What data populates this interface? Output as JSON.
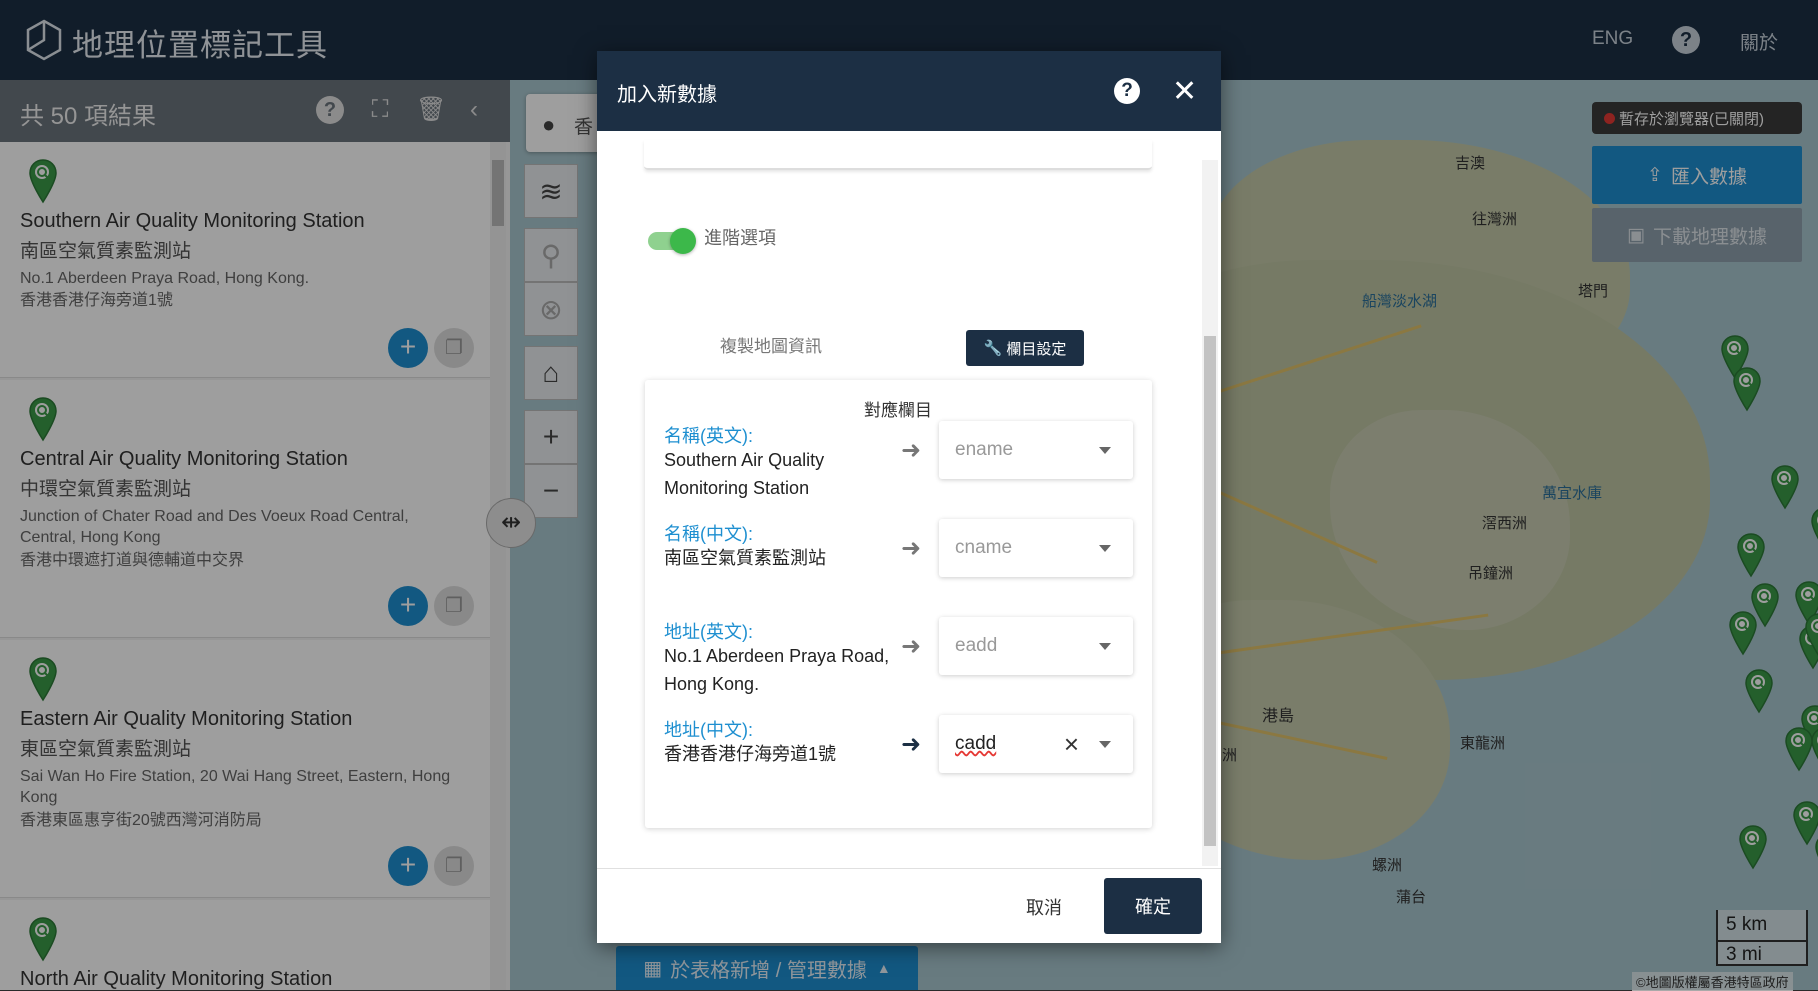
{
  "header": {
    "title": "地理位置標記工具",
    "lang": "ENG",
    "help": "?",
    "about": "關於"
  },
  "sidebar": {
    "result_count": "共 50 項結果",
    "items": [
      {
        "ename": "Southern Air Quality Monitoring Station",
        "cname": "南區空氣質素監測站",
        "eadd": "No.1 Aberdeen Praya Road, Hong Kong.",
        "cadd": "香港香港仔海旁道1號"
      },
      {
        "ename": "Central Air Quality Monitoring Station",
        "cname": "中環空氣質素監測站",
        "eadd": "Junction of Chater Road and Des Voeux Road Central, Central, Hong Kong",
        "cadd": "香港中環遮打道與德輔道中交界"
      },
      {
        "ename": "Eastern Air Quality Monitoring Station",
        "cname": "東區空氣質素監測站",
        "eadd": "Sai Wan Ho Fire Station, 20 Wai Hang Street, Eastern, Hong Kong",
        "cadd": "香港東區惠亨街20號西灣河消防局"
      },
      {
        "ename": "North Air Quality Monitoring Station"
      }
    ]
  },
  "map": {
    "search_placeholder": "香",
    "storage_badge": "暫存於瀏覽器(已關閉)",
    "import_label": "匯入數據",
    "download_label": "下載地理數據",
    "scale_km": "5 km",
    "scale_mi": "3 mi",
    "copyright": "©地圖版權屬香港特區政府",
    "places": [
      "吉澳",
      "往灣洲",
      "船灣淡水湖",
      "塔門",
      "萬宜水庫",
      "滘西洲",
      "吊鐘洲",
      "東龍洲",
      "蒲台",
      "螺洲",
      "港島",
      "洲"
    ],
    "table_button": "於表格新增 / 管理數據"
  },
  "modal": {
    "title": "加入新數據",
    "advanced_label": "進階選項",
    "copy_map_info": "複製地圖資訊",
    "column_settings": "欄目設定",
    "mapping_title": "對應欄目",
    "fields": [
      {
        "label": "名稱(英文):",
        "value": "Southern Air Quality Monitoring Station",
        "selected": "ename",
        "active": false
      },
      {
        "label": "名稱(中文):",
        "value": "南區空氣質素監測站",
        "selected": "cname",
        "active": false
      },
      {
        "label": "地址(英文):",
        "value": "No.1 Aberdeen Praya Road, Hong Kong.",
        "selected": "eadd",
        "active": false
      },
      {
        "label": "地址(中文):",
        "value": "香港香港仔海旁道1號",
        "selected": "cadd",
        "active": true
      }
    ],
    "cancel": "取消",
    "confirm": "確定"
  },
  "colors": {
    "header": "#1c2f44",
    "accent": "#1e8fd0",
    "pin": "#3a9a48"
  }
}
